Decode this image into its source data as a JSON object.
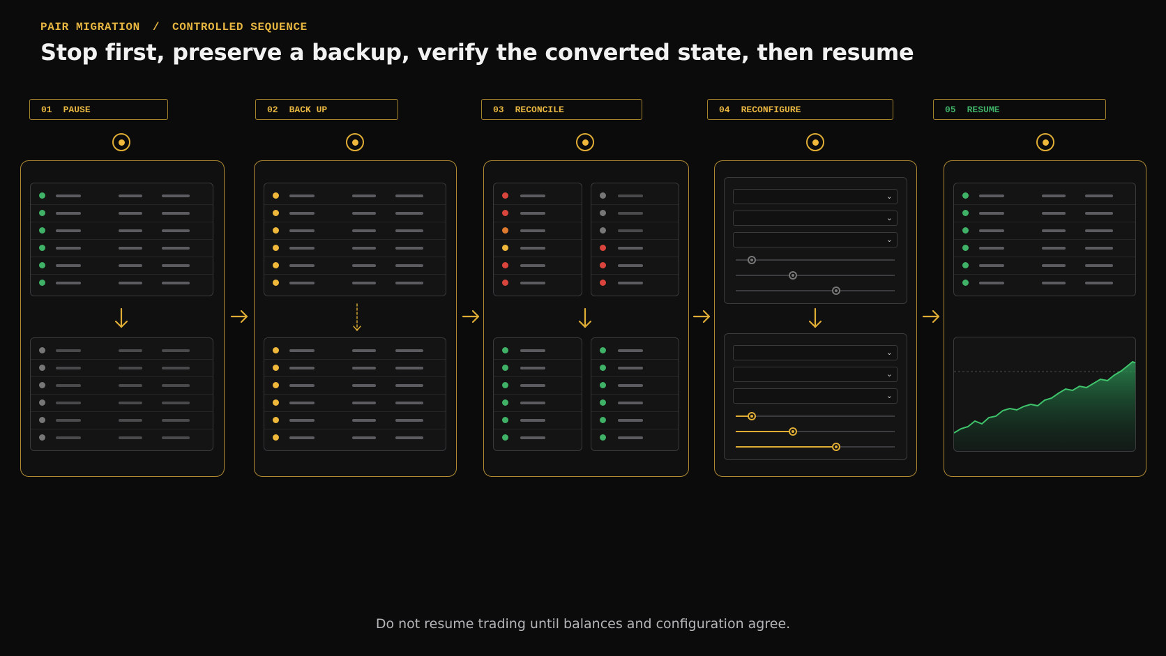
{
  "header": {
    "eyebrow_left": "PAIR MIGRATION",
    "eyebrow_sep": "/",
    "eyebrow_right": "CONTROLLED SEQUENCE",
    "title": "Stop first, preserve a backup, verify the converted state, then resume"
  },
  "steps": [
    {
      "num": "01",
      "label": "PAUSE"
    },
    {
      "num": "02",
      "label": "BACK UP"
    },
    {
      "num": "03",
      "label": "RECONCILE"
    },
    {
      "num": "04",
      "label": "RECONFIGURE"
    },
    {
      "num": "05",
      "label": "RESUME"
    }
  ],
  "footer": "Do not resume trading until balances and configuration agree.",
  "colors": {
    "accent": "#e7b640",
    "green": "#3fb267",
    "red": "#d9453d",
    "orange": "#e07a2e",
    "gray": "#777777",
    "background": "#0b0b0c"
  },
  "step1": {
    "before_status": [
      "green",
      "green",
      "green",
      "green",
      "green",
      "green"
    ],
    "after_status": [
      "gray",
      "gray",
      "gray",
      "gray",
      "gray",
      "gray"
    ]
  },
  "step2": {
    "before_status": [
      "yellow",
      "yellow",
      "yellow",
      "yellow",
      "yellow",
      "yellow"
    ],
    "after_status": [
      "yellow",
      "yellow",
      "yellow",
      "yellow",
      "yellow",
      "yellow"
    ]
  },
  "step3": {
    "left_before": [
      "red",
      "red",
      "orange",
      "yellow",
      "red",
      "red"
    ],
    "right_before": [
      "gray",
      "gray",
      "gray",
      "red",
      "red",
      "red"
    ],
    "left_after": [
      "green",
      "green",
      "green",
      "green",
      "green",
      "green"
    ],
    "right_after": [
      "green",
      "green",
      "green",
      "green",
      "green",
      "green"
    ]
  },
  "step4": {
    "before_sliders": [
      0.1,
      0.36,
      0.63
    ],
    "after_sliders": [
      0.1,
      0.36,
      0.63
    ]
  },
  "step5": {
    "status": [
      "green",
      "green",
      "green",
      "green",
      "green",
      "green"
    ],
    "trend_icon": "rising-area-chart-icon"
  },
  "icons": {
    "step_node": "status-node-icon",
    "flow_arrow": "arrow-right-icon",
    "down_arrow": "arrow-down-icon",
    "dropdown": "chevron-down-icon"
  }
}
